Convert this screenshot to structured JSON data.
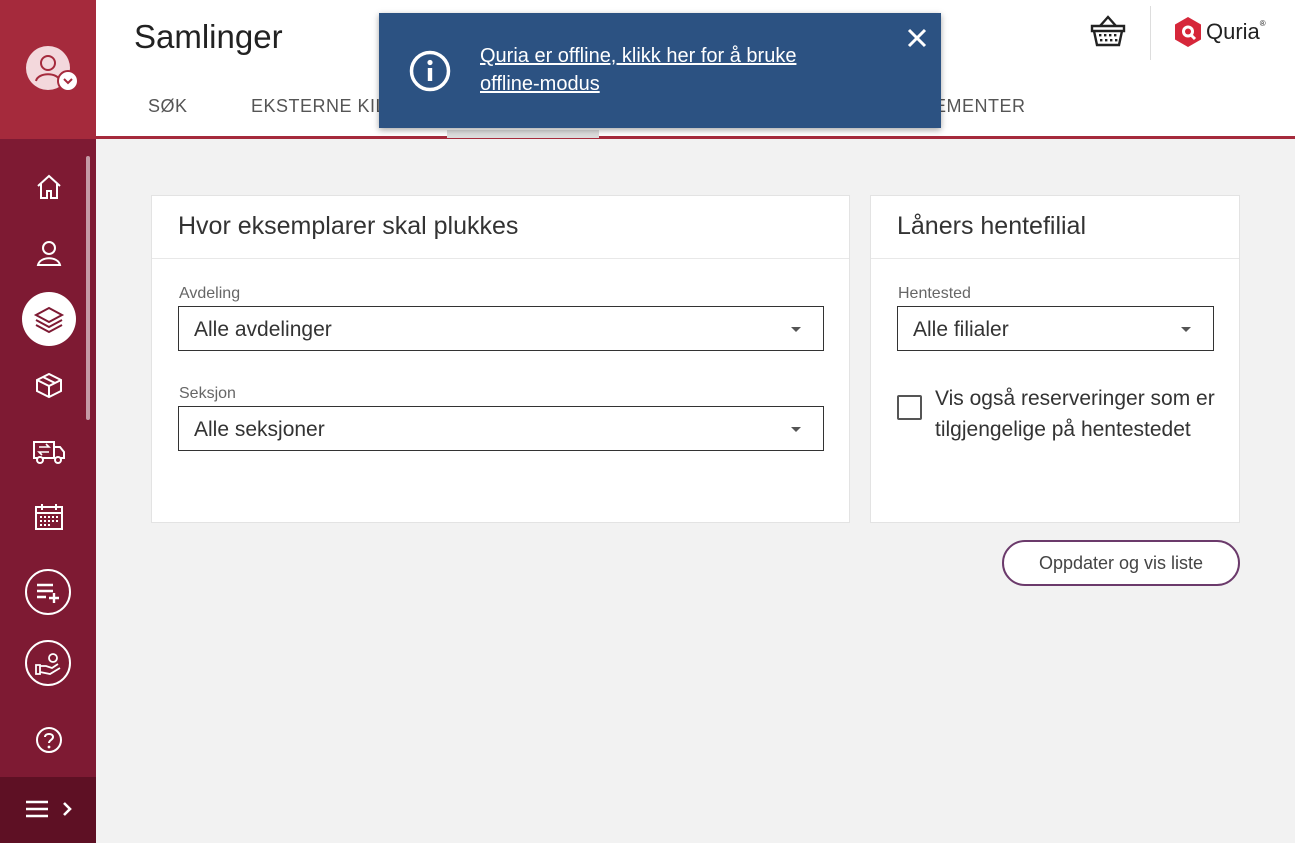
{
  "header": {
    "title": "Samlinger",
    "tabs": [
      {
        "label": "SØK"
      },
      {
        "label": "EKSTERNE KIL"
      },
      {
        "label": "EMENTER"
      }
    ],
    "brand": {
      "name": "Quria",
      "reg": "®",
      "color": "#d6273a"
    }
  },
  "toast": {
    "message": "Quria er offline, klikk her for å bruke offline-modus",
    "close_icon": "close-icon",
    "info_icon": "info-icon"
  },
  "sidebar": {
    "items": [
      {
        "icon": "home-icon"
      },
      {
        "icon": "user-icon"
      },
      {
        "icon": "layers-icon",
        "active": true
      },
      {
        "icon": "package-icon"
      },
      {
        "icon": "truck-transfer-icon"
      },
      {
        "icon": "calendar-icon"
      },
      {
        "icon": "list-add-icon"
      },
      {
        "icon": "hand-give-icon"
      },
      {
        "icon": "help-icon"
      }
    ],
    "menu_icon": "menu-expand-icon"
  },
  "pick_card": {
    "title": "Hvor eksemplarer skal plukkes",
    "department": {
      "label": "Avdeling",
      "value": "Alle avdelinger"
    },
    "section": {
      "label": "Seksjon",
      "value": "Alle seksjoner"
    }
  },
  "branch_card": {
    "title": "Låners hentefilial",
    "pickup": {
      "label": "Hentested",
      "value": "Alle filialer"
    },
    "checkbox_label": "Vis også reserveringer som er tilgjengelige på hentestedet",
    "checkbox_checked": false
  },
  "update_button": {
    "label": "Oppdater og vis liste"
  },
  "colors": {
    "sidebar": "#7e1a33",
    "sidebar_top": "#a52a3c",
    "toast": "#2c5282",
    "button_border": "#6b3a6b"
  }
}
